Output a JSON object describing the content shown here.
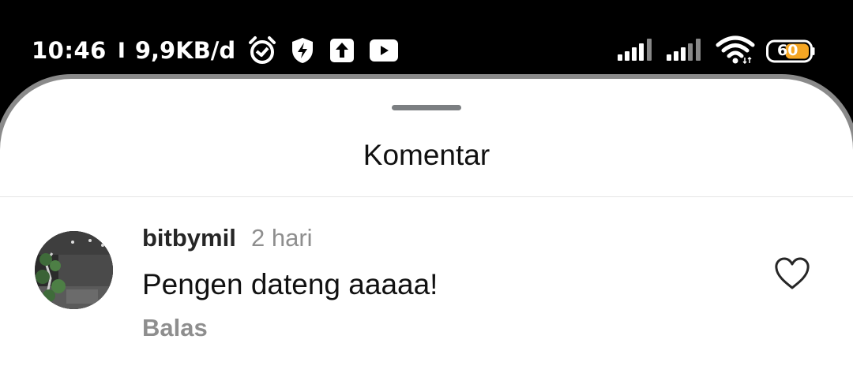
{
  "status_bar": {
    "time": "10:46",
    "separator": "I",
    "net_speed": "9,9KB/d",
    "icons": [
      "alarm-icon",
      "shield-bolt-icon",
      "upload-icon",
      "youtube-icon",
      "signal-icon",
      "signal-icon",
      "wifi-icon",
      "battery-icon"
    ],
    "battery_level": "60",
    "battery_fill_percent": 60,
    "battery_color": "#f5a623"
  },
  "sheet": {
    "title": "Komentar"
  },
  "comment": {
    "username": "bitbymil",
    "time_ago": "2 hari",
    "text": "Pengen dateng aaaaa!",
    "reply_label": "Balas"
  },
  "colors": {
    "muted": "#8e8e8e",
    "text": "#262626"
  }
}
